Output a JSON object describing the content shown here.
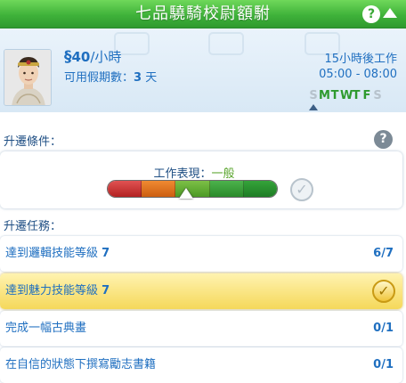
{
  "header": {
    "title": "七品驍騎校尉額駙",
    "help_icon_text": "?",
    "collapse_icon": "triangle-up-icon"
  },
  "career": {
    "salary_symbol": "§",
    "salary_amount": "40",
    "salary_unit": "/小時",
    "vacation_label": "可用假期數：",
    "vacation_value": "3",
    "vacation_unit": " 天",
    "work_in_value": "15",
    "work_in_text": "小時後工作",
    "work_hours": "05:00 - 08:00",
    "days": [
      {
        "letter": "S",
        "working": false
      },
      {
        "letter": "M",
        "working": true
      },
      {
        "letter": "T",
        "working": true
      },
      {
        "letter": "W",
        "working": true
      },
      {
        "letter": "T",
        "working": true
      },
      {
        "letter": "F",
        "working": true
      },
      {
        "letter": "S",
        "working": false
      }
    ]
  },
  "requirements": {
    "section_label": "升遷條件：",
    "help_icon_text": "?",
    "performance_label": "工作表現：",
    "performance_value": "一般",
    "check_icon": "checkmark-icon"
  },
  "tasks": {
    "section_label": "升遷任務：",
    "items": [
      {
        "prefix": "達到邏輯技能等級 ",
        "level": "7",
        "progress": "6/7",
        "complete": false
      },
      {
        "prefix": "達到魅力技能等級 ",
        "level": "7",
        "progress": "",
        "complete": true
      },
      {
        "prefix": "完成一幅古典畫",
        "level": "",
        "progress": "0/1",
        "complete": false
      },
      {
        "prefix": "在自信的狀態下撰寫勵志書籍",
        "level": "",
        "progress": "0/1",
        "complete": false
      }
    ]
  },
  "colors": {
    "header_green": "#3fb23a",
    "text_blue": "#1f6fc0",
    "working_day_green": "#2e9a2e",
    "highlight_gold": "#f5d85a"
  }
}
